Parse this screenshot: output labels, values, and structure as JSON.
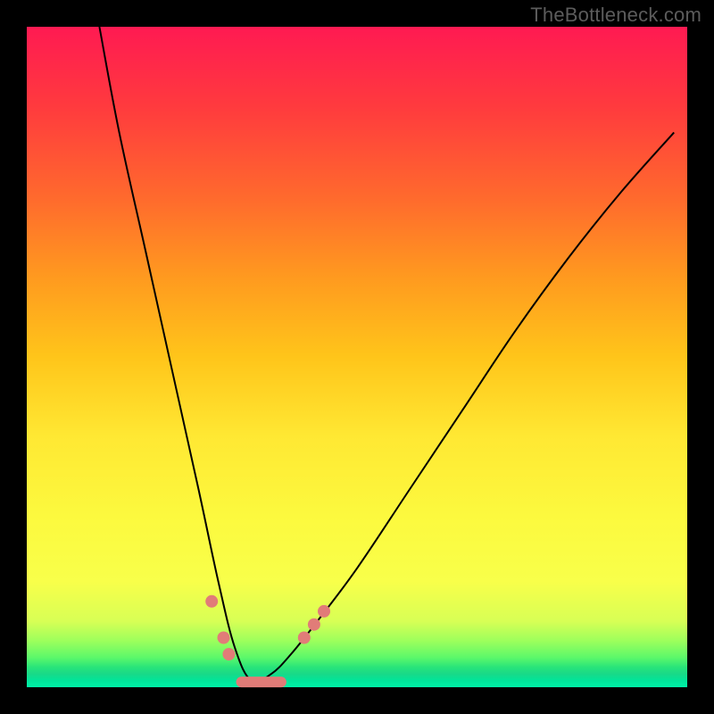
{
  "watermark": "TheBottleneck.com",
  "chart_data": {
    "type": "line",
    "title": "",
    "xlabel": "",
    "ylabel": "",
    "xlim": [
      0,
      100
    ],
    "ylim": [
      0,
      100
    ],
    "grid": false,
    "legend": false,
    "series": [
      {
        "name": "bottleneck-curve",
        "x": [
          11,
          14,
          18,
          22,
          26,
          29,
          31.5,
          34,
          37,
          40,
          44,
          50,
          58,
          66,
          74,
          82,
          90,
          98
        ],
        "y": [
          100,
          84,
          66,
          48,
          30,
          16,
          6,
          1,
          2,
          5,
          10,
          18,
          30,
          42,
          54,
          65,
          75,
          84
        ]
      }
    ],
    "markers": [
      {
        "x": 28.0,
        "y": 13.0
      },
      {
        "x": 29.8,
        "y": 7.5
      },
      {
        "x": 30.6,
        "y": 5.0
      },
      {
        "x": 42.0,
        "y": 7.5
      },
      {
        "x": 43.5,
        "y": 9.5
      },
      {
        "x": 45.0,
        "y": 11.5
      }
    ],
    "valley_flat": {
      "x0": 32.5,
      "x1": 38.5,
      "y": 0.8
    },
    "colors": {
      "curve": "#000000",
      "marker": "#e17c78",
      "background_top": "#ff1a52",
      "background_bottom": "#00f3a8"
    }
  }
}
